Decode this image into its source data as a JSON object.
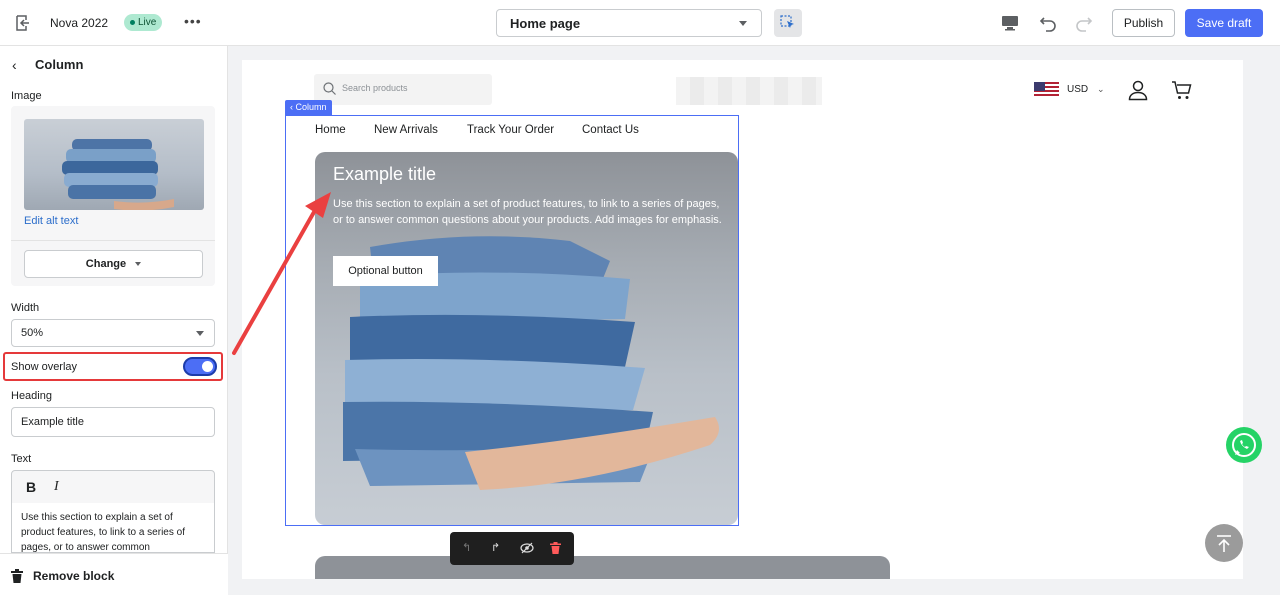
{
  "topbar": {
    "store_name": "Nova 2022",
    "status": "Live",
    "more_label": "•••",
    "page_selector": "Home page",
    "publish_label": "Publish",
    "save_label": "Save draft"
  },
  "sidebar": {
    "back_label": "‹",
    "title": "Column",
    "image_label": "Image",
    "edit_alt_text": "Edit alt text",
    "change_label": "Change",
    "width_label": "Width",
    "width_value": "50%",
    "show_overlay_label": "Show overlay",
    "show_overlay_on": true,
    "heading_label": "Heading",
    "heading_value": "Example title",
    "text_label": "Text",
    "bold_label": "B",
    "italic_label": "I",
    "text_value": "Use this section to explain a set of product features, to link to a series of pages, or to answer common",
    "remove_block_label": "Remove block"
  },
  "preview": {
    "search_placeholder": "Search products",
    "currency": "USD",
    "column_tag": "Column",
    "nav": [
      "Home",
      "New Arrivals",
      "Track Your Order",
      "Contact Us"
    ],
    "hero": {
      "title": "Example title",
      "text": "Use this section to explain a set of product features, to link to a series of pages, or to answer common questions about your products. Add images for emphasis.",
      "button": "Optional button"
    }
  },
  "colors": {
    "accent": "#4c6ef5",
    "highlight": "#e5393a",
    "live_badge": "#aee9d1",
    "whatsapp": "#25d366"
  }
}
